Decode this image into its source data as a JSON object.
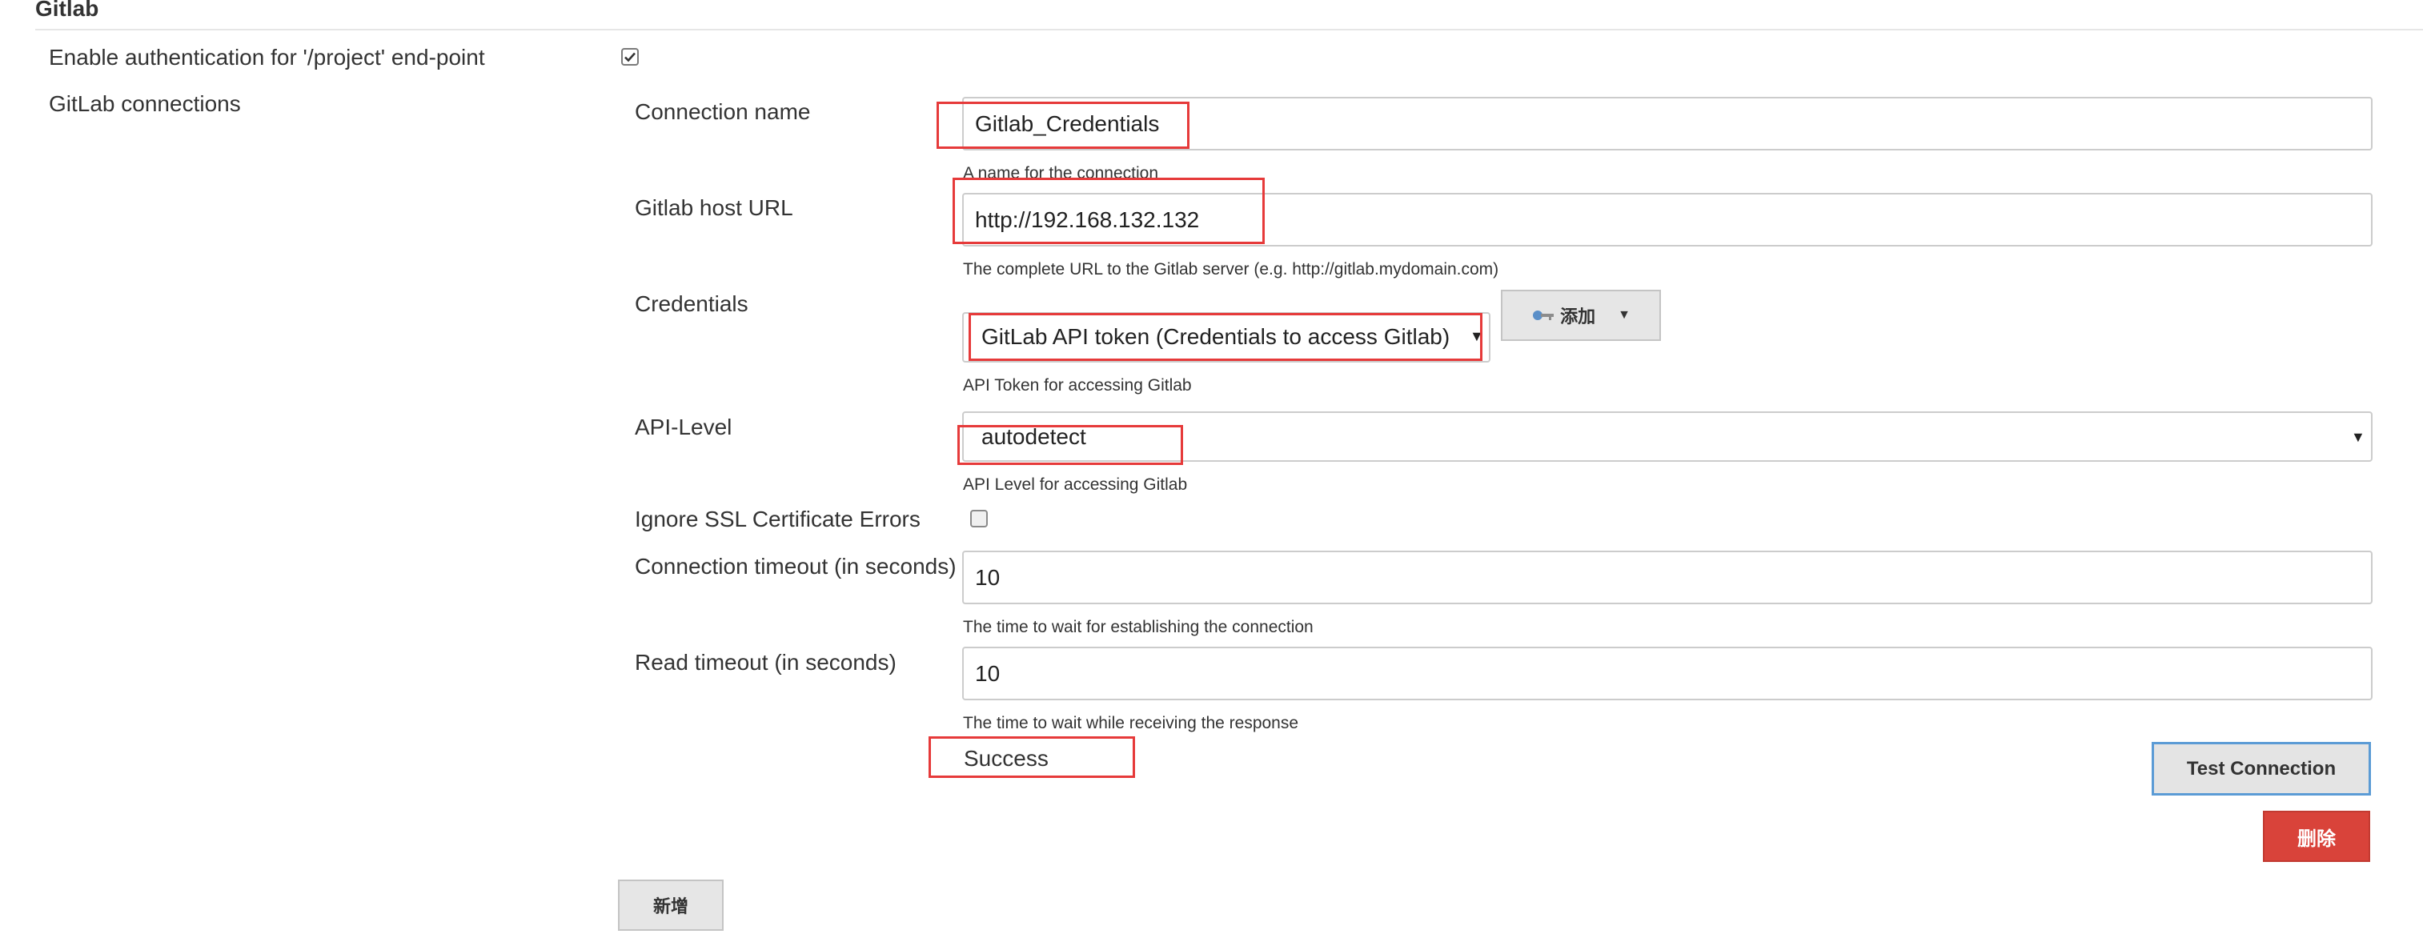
{
  "section": {
    "title": "Gitlab"
  },
  "auth": {
    "label": "Enable authentication for '/project' end-point",
    "checked": true
  },
  "connections": {
    "label": "GitLab connections",
    "connection_name": {
      "label": "Connection name",
      "value": "Gitlab_Credentials",
      "help": "A name for the connection"
    },
    "host_url": {
      "label": "Gitlab host URL",
      "value": "http://192.168.132.132",
      "help": "The complete URL to the Gitlab server (e.g. http://gitlab.mydomain.com)"
    },
    "credentials": {
      "label": "Credentials",
      "selected": "GitLab API token (Credentials to access Gitlab)",
      "help": "API Token for accessing Gitlab",
      "add_button": {
        "label": "添加",
        "icon": "key-icon"
      }
    },
    "api_level": {
      "label": "API-Level",
      "selected": "autodetect",
      "help": "API Level for accessing Gitlab"
    },
    "ignore_ssl": {
      "label": "Ignore SSL Certificate Errors",
      "checked": false
    },
    "connection_timeout": {
      "label": "Connection timeout (in seconds)",
      "value": "10",
      "help": "The time to wait for establishing the connection"
    },
    "read_timeout": {
      "label": "Read timeout (in seconds)",
      "value": "10",
      "help": "The time to wait while receiving the response"
    },
    "status": "Success",
    "test_button": "Test Connection",
    "delete_button": "删除"
  },
  "add_button": "新增",
  "colors": {
    "highlight_frame": "#e63a3a",
    "delete_button": "#d9433a",
    "test_button_border": "#5b9bd5"
  }
}
